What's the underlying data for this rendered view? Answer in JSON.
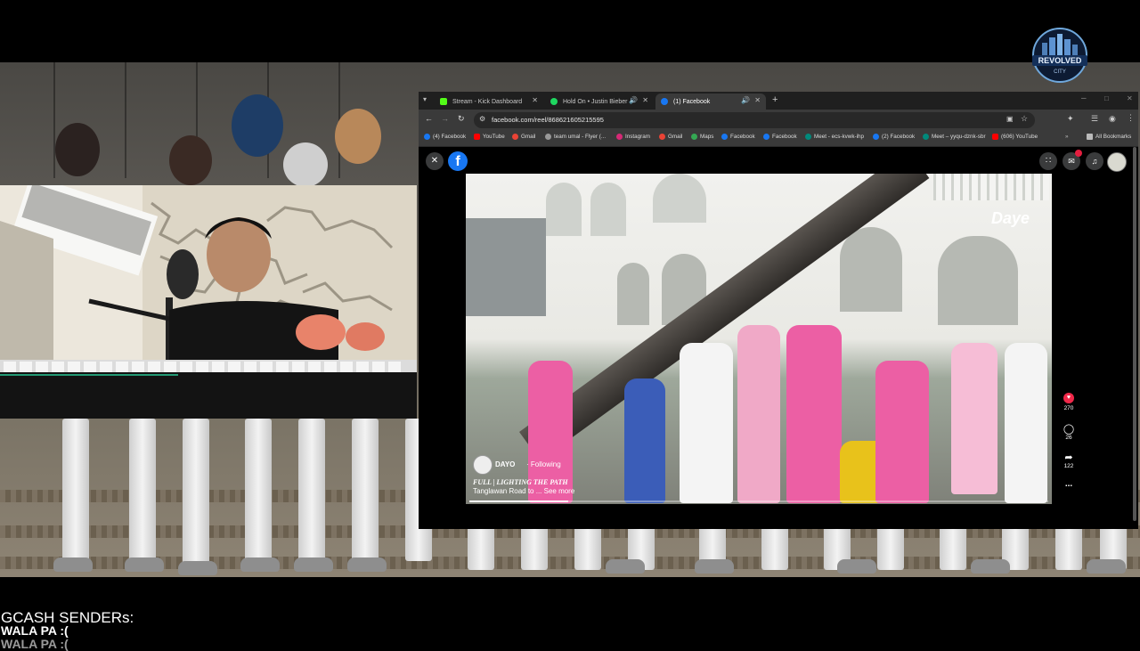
{
  "overlay": {
    "logo_text": "REVOLVED",
    "logo_subtext": "CITY",
    "gcash_title": "GCASH SENDERs:",
    "gcash_line1": "WALA PA :(",
    "gcash_line2": "WALA PA :("
  },
  "browser": {
    "tabs": [
      {
        "label": "Stream - Kick Dashboard",
        "color": "#53fc18",
        "active": false
      },
      {
        "label": "Hold On • Justin Bieber",
        "color": "#1ed760",
        "active": false
      },
      {
        "label": "(1) Facebook",
        "color": "#1877f2",
        "active": true
      }
    ],
    "url": "facebook.com/reel/868621605215595",
    "bookmarks": [
      {
        "label": "(4) Facebook",
        "color": "#1877f2"
      },
      {
        "label": "YouTube",
        "color": "#ff0000"
      },
      {
        "label": "Gmail",
        "color": "#ea4335"
      },
      {
        "label": "team umal - Flyer (...",
        "color": "#4a4a4a"
      },
      {
        "label": "Instagram",
        "color": "#d62976"
      },
      {
        "label": "Gmail",
        "color": "#ea4335"
      },
      {
        "label": "Maps",
        "color": "#34a853"
      },
      {
        "label": "Facebook",
        "color": "#1877f2"
      },
      {
        "label": "Facebook",
        "color": "#1877f2"
      },
      {
        "label": "Meet - ecs-kvwk-ihp",
        "color": "#00897b"
      },
      {
        "label": "(2) Facebook",
        "color": "#1877f2"
      },
      {
        "label": "Meet – yyqu-dznk-sbr",
        "color": "#00897b"
      },
      {
        "label": "(606) YouTube",
        "color": "#ff0000"
      }
    ],
    "all_bookmarks": "All Bookmarks"
  },
  "reel": {
    "author": "DAYO",
    "follow_status": "· Following",
    "caption_title": "FULL | LIGHTING THE PATH",
    "caption_text": "Tanglawan Road to ... See more",
    "watermark": "Daye",
    "likes": "270",
    "comments": "26",
    "shares": "122",
    "more": "..."
  },
  "colors": {
    "facebook_blue": "#1877f2",
    "like_red": "#f02849",
    "pink_shirt": "#ec5fa4"
  }
}
